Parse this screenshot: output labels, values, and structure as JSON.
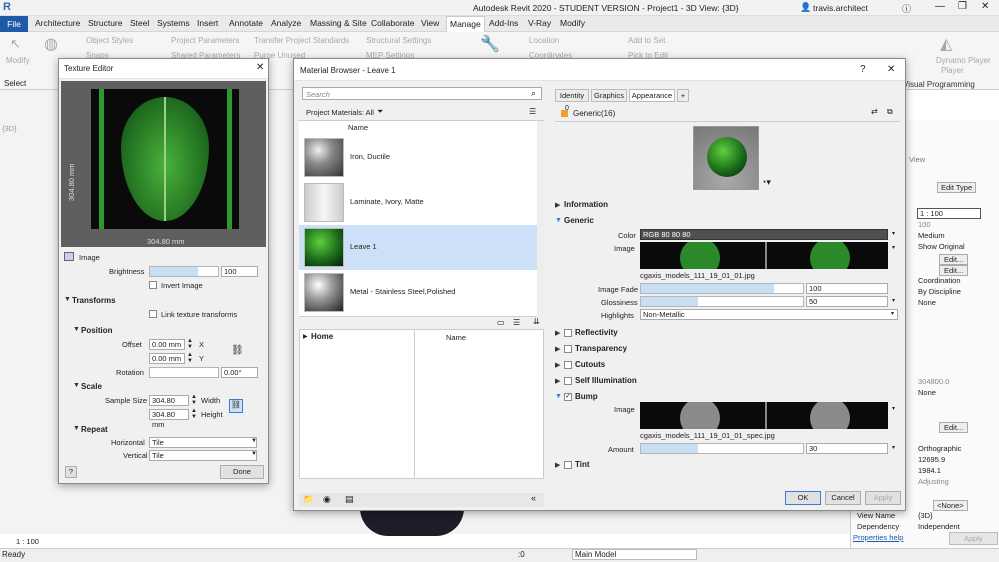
{
  "app": {
    "title": "Autodesk Revit 2020 - STUDENT VERSION - Project1 - 3D View: {3D}",
    "user": "travis.architect"
  },
  "menu": [
    "File",
    "Architecture",
    "Structure",
    "Steel",
    "Systems",
    "Insert",
    "Annotate",
    "Analyze",
    "Massing & Site",
    "Collaborate",
    "View",
    "Manage",
    "Add-Ins",
    "V-Ray",
    "Modify"
  ],
  "ribbon": {
    "modify": "Modify",
    "object_styles": "Object Styles",
    "snaps": "Snaps",
    "project_parameters": "Project Parameters",
    "shared_parameters": "Shared Parameters",
    "transfer_standards": "Transfer Project Standards",
    "purge_unused": "Purge Unused",
    "structural_settings": "Structural Settings",
    "mep_settings": "MEP Settings",
    "location": "Location",
    "coordinates": "Coordinates",
    "add_to_set": "Add to Set",
    "pick_to_edit": "Pick to Edit",
    "dynamo_player": "Dynamo Player",
    "dynamo_player2": "Player",
    "visual_programming": "Visual Programming",
    "select": "Select"
  },
  "texture_editor": {
    "title": "Texture Editor",
    "dim_vertical": "304.80 mm",
    "dim_horizontal": "304.80 mm",
    "image_label": "Image",
    "brightness_label": "Brightness",
    "brightness_value": "100",
    "brightness_level": 0.7,
    "invert_label": "Invert Image",
    "transforms": "Transforms",
    "link_label": "Link texture transforms",
    "position": "Position",
    "offset_label": "Offset",
    "offset_x": "0.00 mm",
    "offset_y": "0.00 mm",
    "x": "X",
    "y": "Y",
    "rotation_label": "Rotation",
    "rotation_value": "0.00°",
    "scale": "Scale",
    "sample_size_label": "Sample Size",
    "width_value": "304.80 mm",
    "height_value": "304.80 mm",
    "width_label": "Width",
    "height_label": "Height",
    "repeat": "Repeat",
    "horizontal_label": "Horizontal",
    "horizontal_value": "Tile",
    "vertical_label": "Vertical",
    "vertical_value": "Tile",
    "help": "?",
    "done": "Done"
  },
  "material_browser": {
    "title": "Material Browser - Leave 1",
    "search_placeholder": "Search",
    "project_materials": "Project Materials: All",
    "name_col": "Name",
    "materials": [
      {
        "name": "Iron, Ductile",
        "kind": "metal"
      },
      {
        "name": "Laminate, Ivory, Matte",
        "kind": "ivory"
      },
      {
        "name": "Leave 1",
        "kind": "leaf"
      },
      {
        "name": "Metal - Stainless Steel,Polished",
        "kind": "steel"
      }
    ],
    "selected_index": 2,
    "home": "Home",
    "name_col2": "Name"
  },
  "editor": {
    "tabs": [
      "Identity",
      "Graphics",
      "Appearance",
      "+"
    ],
    "active_tab": "Appearance",
    "asset_count": "0",
    "asset_name": "Generic(16)",
    "information": "Information",
    "generic": "Generic",
    "color_label": "Color",
    "color_value": "RGB 80 80 80",
    "image_label": "Image",
    "image_file": "cgaxis_models_111_19_01_01.jpg",
    "image_fade_label": "Image Fade",
    "image_fade_value": "100",
    "image_fade_level": 0.82,
    "glossiness_label": "Glossiness",
    "glossiness_value": "50",
    "glossiness_level": 0.35,
    "highlights_label": "Highlights",
    "highlights_value": "Non-Metallic",
    "sections": [
      "Reflectivity",
      "Transparency",
      "Cutouts",
      "Self Illumination"
    ],
    "bump": "Bump",
    "bump_image_label": "Image",
    "bump_file": "cgaxis_models_111_19_01_01_spec.jpg",
    "amount_label": "Amount",
    "amount_value": "30",
    "amount_level": 0.35,
    "tint": "Tint",
    "ok": "OK",
    "cancel": "Cancel",
    "apply": "Apply"
  },
  "properties": {
    "scale": "1 : 100",
    "scale_value": "100",
    "detail": "Medium",
    "parts": "Show Original",
    "edit": "Edit...",
    "discipline": "Coordination",
    "color_scheme": "By Discipline",
    "none": "None",
    "far_clip": "304800.0",
    "none2": "None",
    "orthographic": "Orthographic",
    "eye": "12695.9",
    "target": "1984.1",
    "adjusting": "Adjusting",
    "none3": "<None>",
    "view_name_label": "View Name",
    "view_name_value": "{3D}",
    "dependency_label": "Dependency",
    "dependency_value": "Independent",
    "help_link": "Properties help",
    "apply": "Apply",
    "view_label": "View",
    "edit_type": "Edit Type"
  },
  "status": {
    "ready": "Ready",
    "zero": ":0",
    "model": "Main Model",
    "scale": "1 : 100",
    "tab3d": "{3D}"
  }
}
